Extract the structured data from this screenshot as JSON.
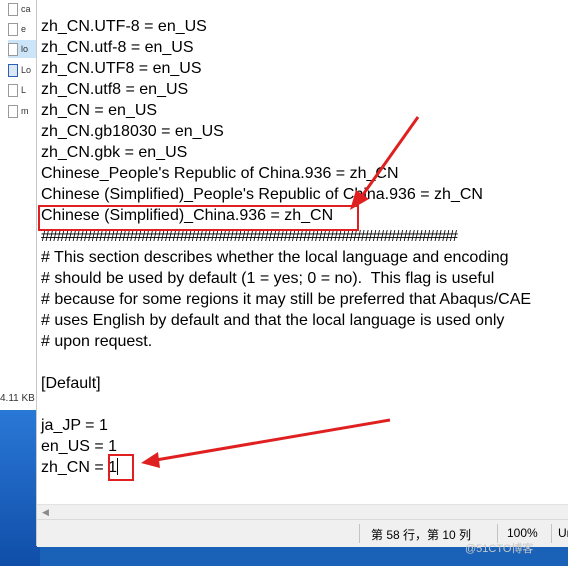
{
  "background": {
    "files": [
      {
        "label": "ca",
        "icon": "file-icon"
      },
      {
        "label": "e",
        "icon": "file-icon"
      },
      {
        "label": "lo",
        "icon": "text-file-icon"
      },
      {
        "label": "Lo",
        "icon": "image-file-icon"
      },
      {
        "label": "L",
        "icon": "file-icon"
      },
      {
        "label": "m",
        "icon": "file-icon"
      }
    ],
    "size_text": "4.11 KB"
  },
  "editor": {
    "lines": [
      "zh_CN.UTF-8 = en_US",
      "zh_CN.utf-8 = en_US",
      "zh_CN.UTF8 = en_US",
      "zh_CN.utf8 = en_US",
      "zh_CN = en_US",
      "zh_CN.gb18030 = en_US",
      "zh_CN.gbk = en_US",
      "Chinese_People's Republic of China.936 = zh_CN",
      "Chinese (Simplified)_People's Republic of China.936 = zh_CN",
      "Chinese (Simplified)_China.936 = zh_CN",
      "######################################################",
      "# This section describes whether the local language and encoding",
      "# should be used by default (1 = yes; 0 = no).  This flag is useful",
      "# because for some regions it may still be preferred that Abaqus/CAE",
      "# uses English by default and that the local language is used only",
      "# upon request.",
      "",
      "[Default]",
      "",
      "ja_JP = 1",
      "en_US = 1",
      "zh_CN = 1"
    ]
  },
  "statusbar": {
    "position": "第 58 行，第 10 列",
    "zoom": "100%",
    "line_ending": "Un"
  },
  "watermark": "@51CTO博客",
  "colors": {
    "annotation_red": "#e02020",
    "wallpaper_blue": "#1a62b8"
  }
}
